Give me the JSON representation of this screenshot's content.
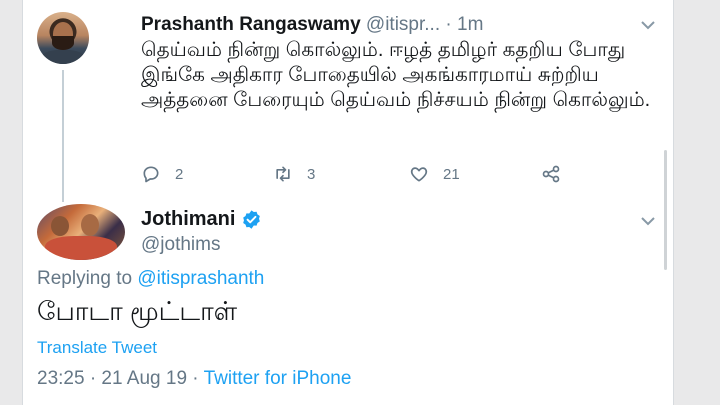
{
  "tweet1": {
    "name": "Prashanth Rangaswamy",
    "handle": "@itispr...",
    "separator": "·",
    "time": "1m",
    "text": "தெய்வம் நின்று கொல்லும். ஈழத் தமிழர் கதறிய போது இங்கே அதிகார போதையில் அகங்காரமாய் சுற்றிய அத்தனை பேரையும் தெய்வம் நிச்சயம் நின்று கொல்லும்.",
    "reply_count": "2",
    "retweet_count": "3",
    "like_count": "21",
    "icons": [
      "reply-icon",
      "retweet-icon",
      "like-icon",
      "share-icon",
      "chevron-down-icon"
    ]
  },
  "tweet2": {
    "name": "Jothimani",
    "handle": "@jothims",
    "replying_prefix": "Replying to",
    "replying_to": "@itisprashanth",
    "text": "போடா மூட்டாள்",
    "translate_label": "Translate Tweet",
    "timestamp": "23:25 · 21 Aug 19 ·",
    "source": "Twitter for iPhone",
    "icons": [
      "verified-icon",
      "chevron-down-icon"
    ]
  },
  "colors": {
    "accent": "#1da1f2",
    "secondary_text": "#657786",
    "primary_text": "#14171a"
  }
}
